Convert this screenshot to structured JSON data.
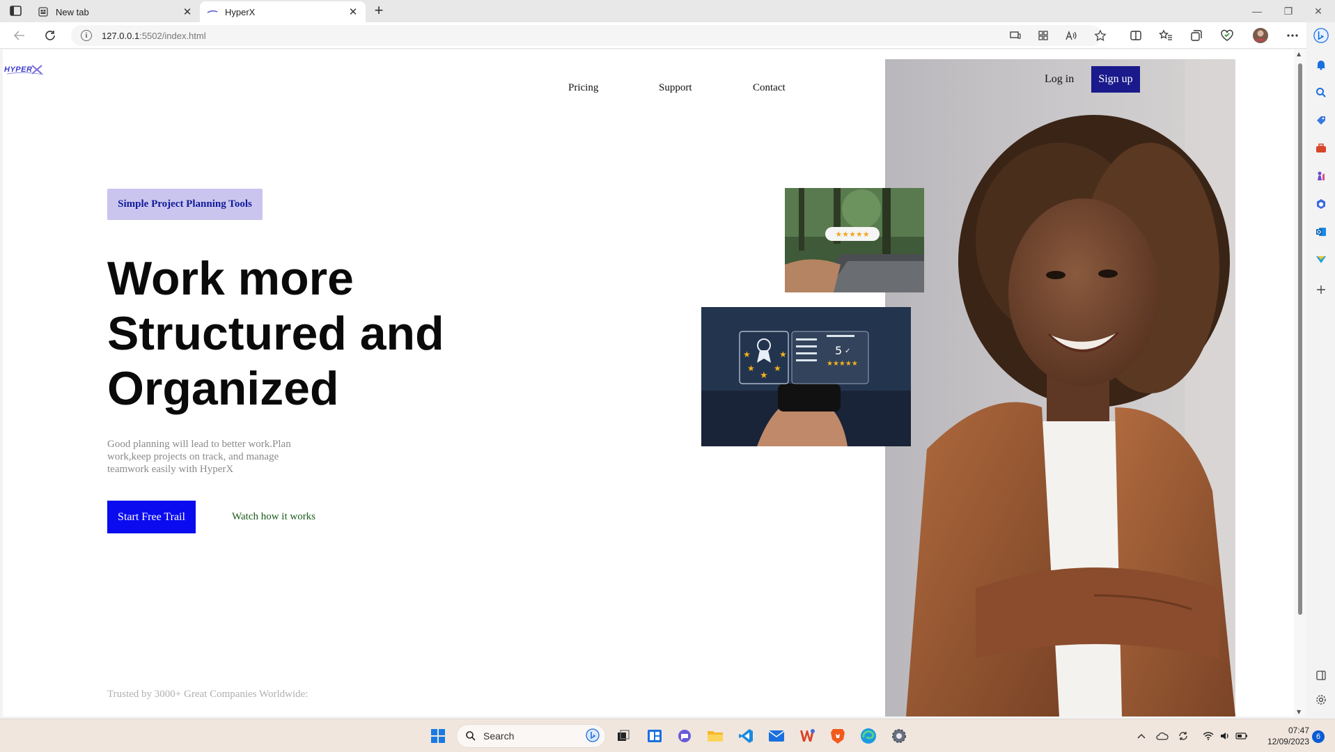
{
  "browser": {
    "tabs": [
      {
        "title": "New tab",
        "active": false
      },
      {
        "title": "HyperX",
        "active": true
      }
    ],
    "address": {
      "host": "127.0.0.1",
      "path": ":5502/index.html"
    }
  },
  "nav": {
    "links": [
      "Pricing",
      "Support",
      "Contact"
    ],
    "login": "Log in",
    "signup": "Sign up"
  },
  "hero": {
    "badge": "Simple Project Planning Tools",
    "headline": [
      "Work more",
      "Structured and",
      "Organized"
    ],
    "subtext": "Good planning will lead to better work.Plan work,keep projects on track, and manage teamwork easily with HyperX",
    "cta_primary": "Start Free Trail",
    "cta_secondary": "Watch how it works",
    "trusted": "Trusted by 3000+ Great Companies Worldwide:"
  },
  "images": {
    "card_top": "laptop-review-stars",
    "card_bottom": "phone-customer-satisfaction",
    "photo": "woman-portrait"
  },
  "taskbar": {
    "search_placeholder": "Search",
    "time": "07:47",
    "date": "12/09/2023",
    "notifications": "6"
  },
  "colors": {
    "signup_bg": "#1a1a8c",
    "cta_bg": "#0b0bf0",
    "badge_bg": "#c9c5ee",
    "badge_text": "#111a9a"
  }
}
